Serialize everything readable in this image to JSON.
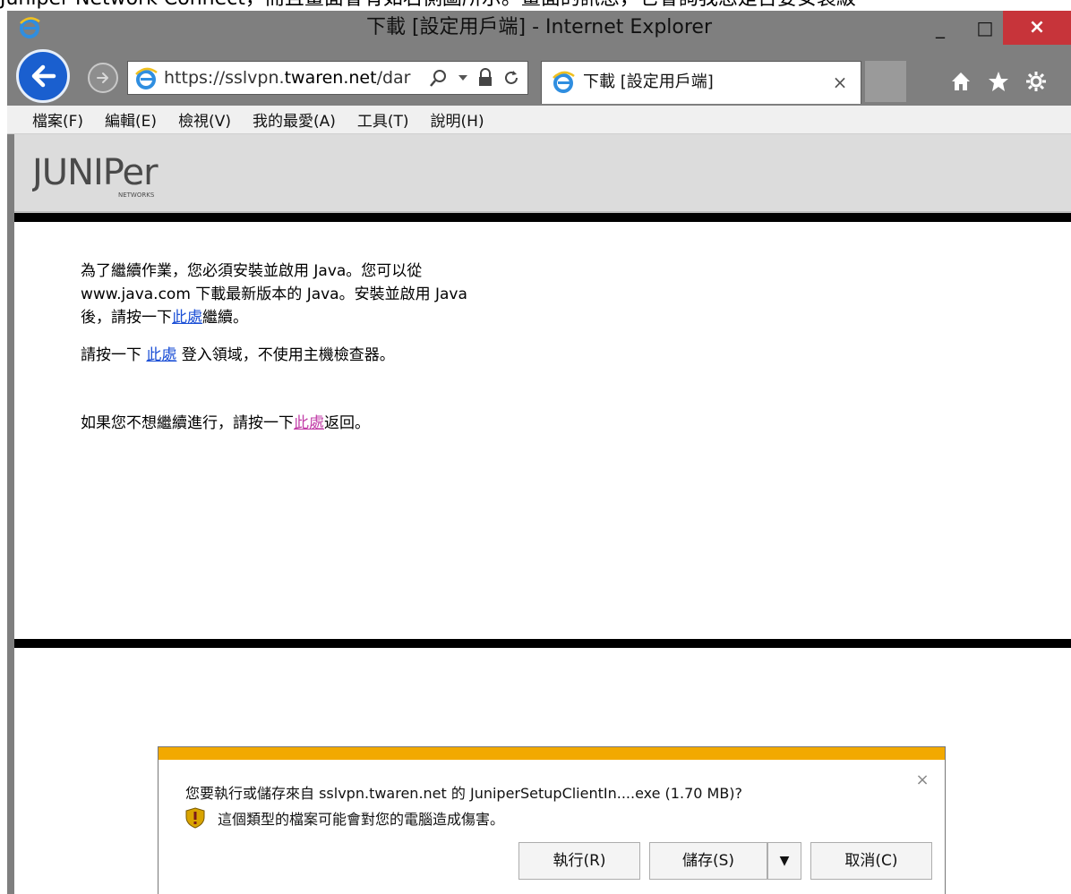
{
  "page_caption": "Juniper Network Connect，而且畫面會有如右側圖所示。畫面的訊息，它會詢我您是否要安裝級",
  "window": {
    "title": "下載 [設定用戶端] - Internet Explorer",
    "minimize": "_",
    "maximize": "□",
    "close": "×"
  },
  "address": {
    "url_prefix": "https://sslvpn.",
    "url_host": "twaren.net",
    "url_rest": "/dar",
    "search_icon": "search-icon",
    "dropdown_icon": "chevron-down-icon",
    "lock_icon": "lock-icon",
    "refresh_icon": "refresh-icon"
  },
  "tab": {
    "label": "下載 [設定用戶端]",
    "close": "×"
  },
  "menu": [
    {
      "label": "檔案(F)"
    },
    {
      "label": "編輯(E)"
    },
    {
      "label": "檢視(V)"
    },
    {
      "label": "我的最愛(A)"
    },
    {
      "label": "工具(T)"
    },
    {
      "label": "說明(H)"
    }
  ],
  "header": {
    "logo_text": "JUNIPer",
    "logo_sub": "NETWORKS"
  },
  "content": {
    "para1_a": "為了繼續作業，您必須安裝並啟用 Java。您可以從",
    "para1_b": "www.java.com 下載最新版本的 Java。安裝並啟用 Java",
    "para1_c_before": "後，請按一下",
    "para1_link": "此處",
    "para1_c_after": "繼續。",
    "para2_before": "請按一下 ",
    "para2_link": "此處",
    "para2_after": " 登入領域，不使用主機檢查器。",
    "para3_before": "如果您不想繼續進行，請按一下",
    "para3_link": "此處",
    "para3_after": "返回。"
  },
  "download_bar": {
    "message_prefix": "您要執行或儲存來自 ",
    "message_host": "sslvpn.twaren.net",
    "message_mid": " 的 ",
    "message_file": "JuniperSetupClientIn....exe",
    "message_size": " (1.70 MB)?",
    "warning": "這個類型的檔案可能會對您的電腦造成傷害。",
    "run_label": "執行(R)",
    "save_label": "儲存(S)",
    "save_arrow": "▼",
    "cancel_label": "取消(C)",
    "close": "×",
    "accent_color": "#f2a900"
  }
}
